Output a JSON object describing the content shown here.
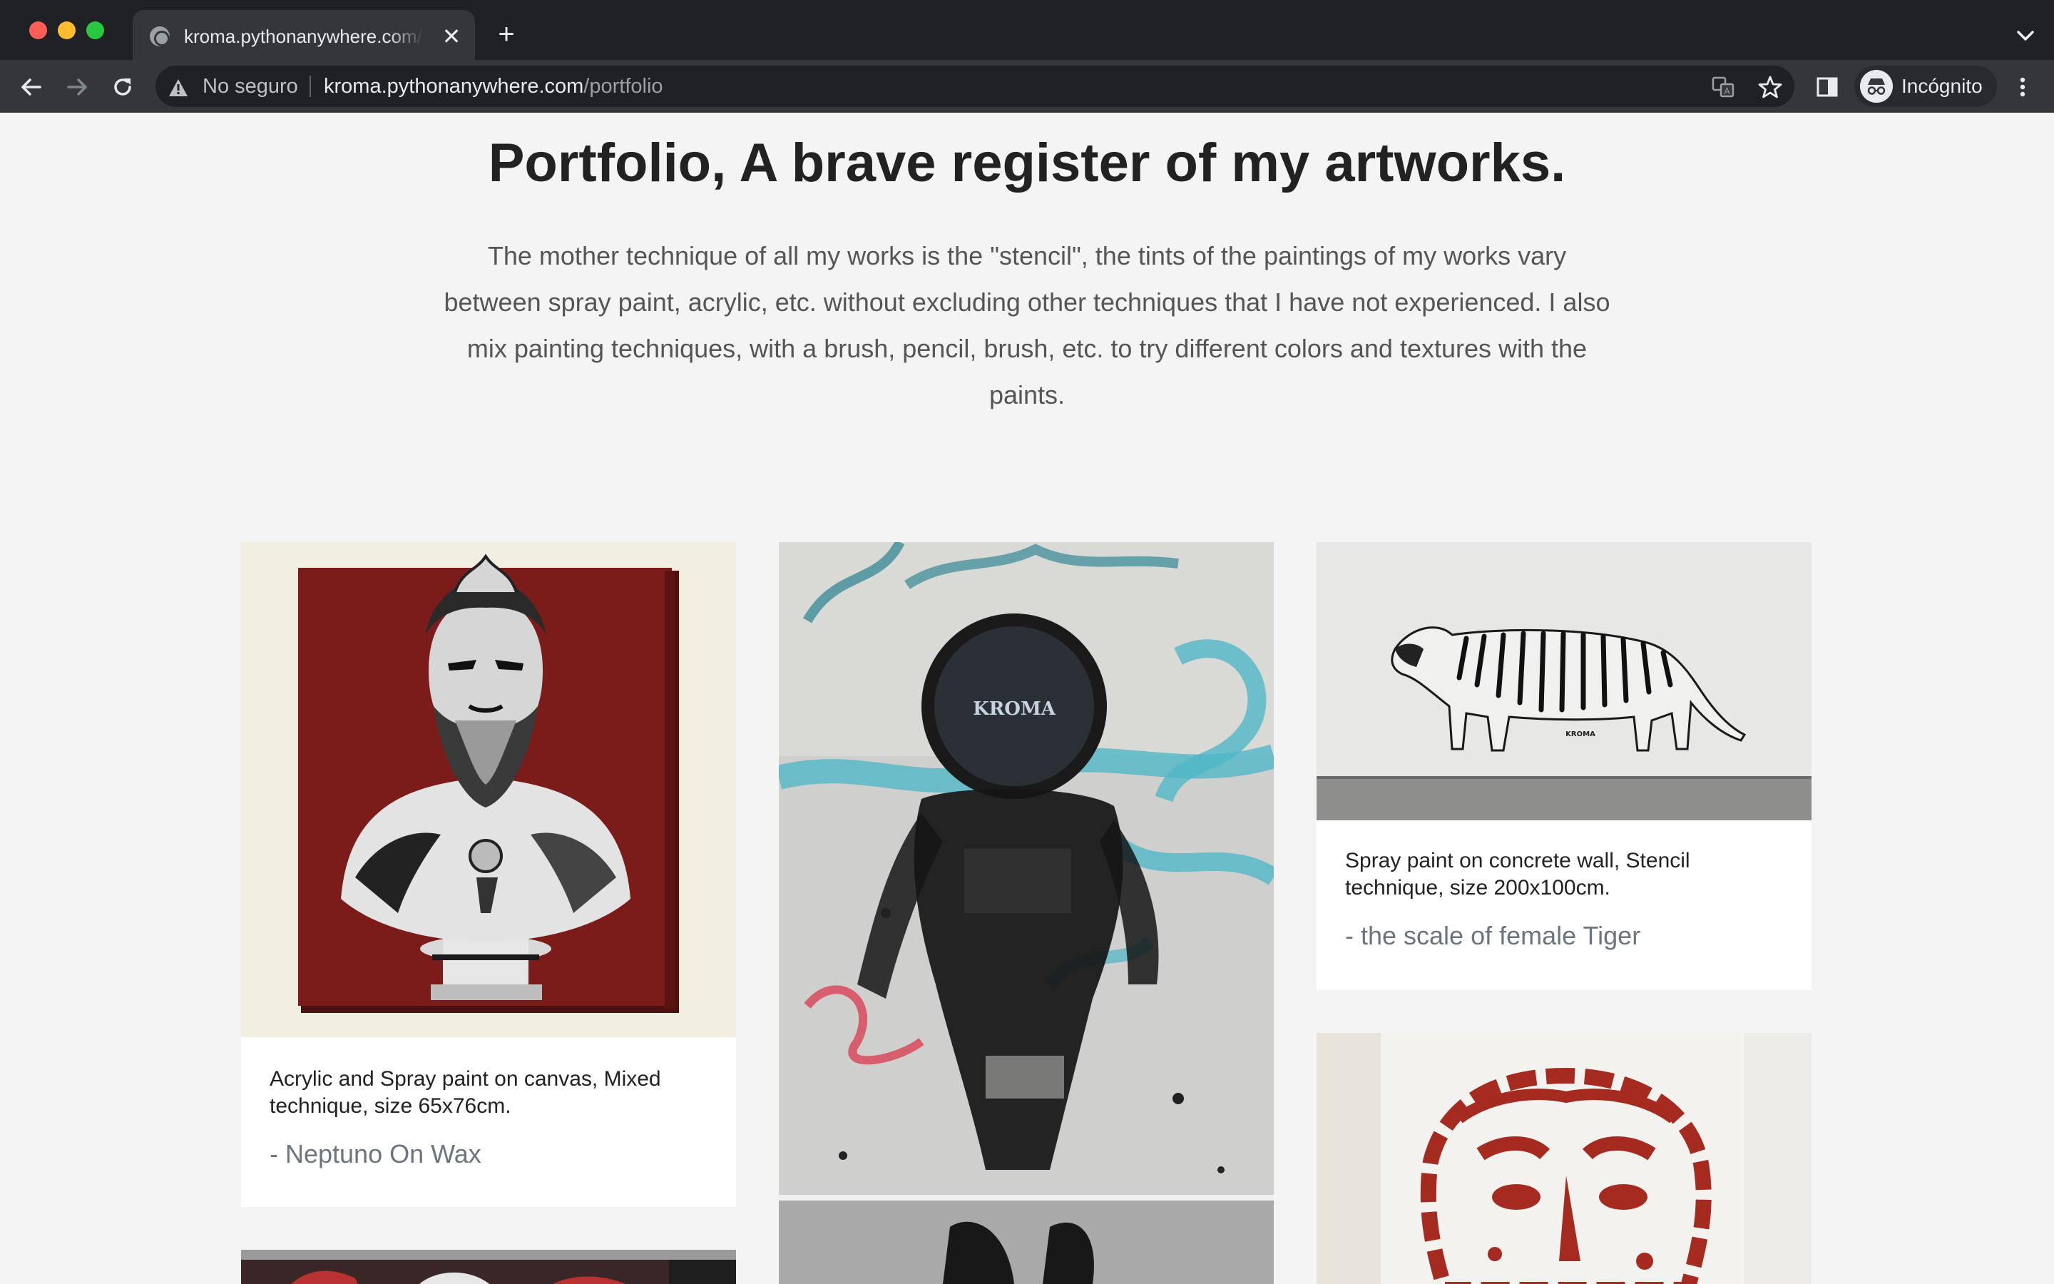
{
  "browser": {
    "tab": {
      "title": "kroma.pythonanywhere.com/portfolio",
      "close_glyph": "✕"
    },
    "new_tab_glyph": "+",
    "omnibox": {
      "security_label": "No seguro",
      "url_host": "kroma.pythonanywhere.com",
      "url_path": "/portfolio"
    },
    "profile_label": "Incógnito",
    "icons": [
      "globe-icon",
      "back-icon",
      "forward-icon",
      "reload-icon",
      "warning-icon",
      "translate-icon",
      "star-icon",
      "side-panel-icon",
      "incognito-icon",
      "menu-icon",
      "tab-search-icon"
    ]
  },
  "page": {
    "heading_bold": "Portfolio",
    "heading_rest": ", A brave register of my artworks.",
    "intro": "The mother technique of all my works is the \"stencil\", the tints of the paintings of my works vary between spray paint, acrylic, etc. without excluding other techniques that I have not experienced. I also mix painting techniques, with a brush, pencil, brush, etc. to try different colors and textures with the paints."
  },
  "artworks": [
    {
      "description": "Acrylic and Spray paint on canvas, Mixed technique, size 65x76cm.",
      "title": "- Neptuno On Wax"
    },
    {
      "image_text": "KROMA"
    },
    {
      "description": "Spray paint on concrete wall, Stencil technique, size 200x100cm.",
      "title": "- the scale of female Tiger",
      "image_text": "KROMA"
    }
  ],
  "colors": {
    "chrome_dark": "#202124",
    "chrome_toolbar": "#35363a",
    "page_bg": "#f4f4f4",
    "heading": "#222222",
    "muted_title": "#6c757d"
  }
}
